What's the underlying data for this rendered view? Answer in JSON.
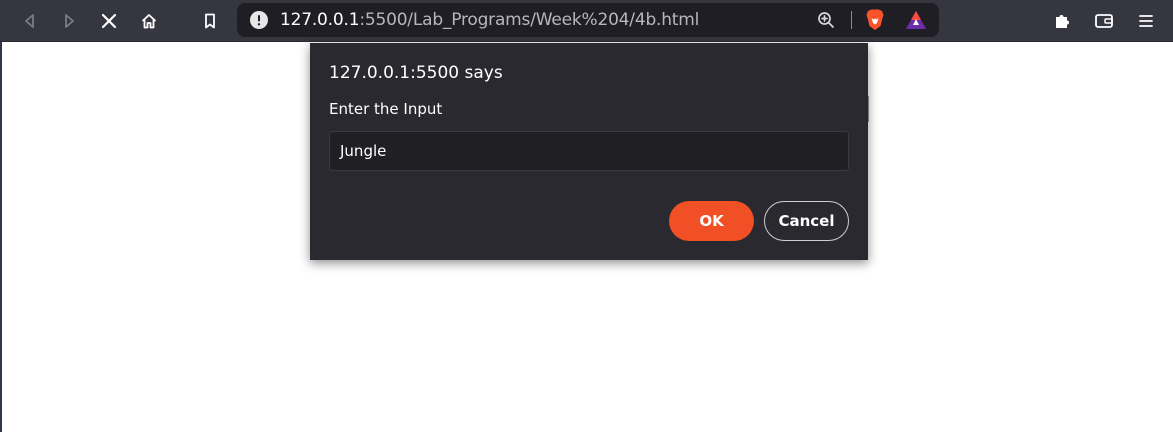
{
  "browser": {
    "address": {
      "host": "127.0.0.1",
      "rest": ":5500/Lab_Programs/Week%204/4b.html"
    },
    "icons": {
      "back": "back-arrow-icon",
      "forward": "forward-arrow-icon",
      "stop": "stop-icon",
      "home": "home-icon",
      "bookmark": "bookmark-icon",
      "site_info": "info-icon",
      "zoom": "zoom-icon",
      "brave_shields": "brave-shields-icon",
      "rewards": "brave-rewards-icon",
      "extensions": "puzzle-icon",
      "wallet": "wallet-icon",
      "menu": "menu-icon"
    },
    "colors": {
      "toolbar": "#363641",
      "urlbar": "#1e1e24"
    }
  },
  "dialog": {
    "title": "127.0.0.1:5500 says",
    "message": "Enter the Input",
    "input_value": "Jungle",
    "ok_label": "OK",
    "cancel_label": "Cancel",
    "colors": {
      "background": "#29292f",
      "ok": "#f14f25"
    }
  }
}
